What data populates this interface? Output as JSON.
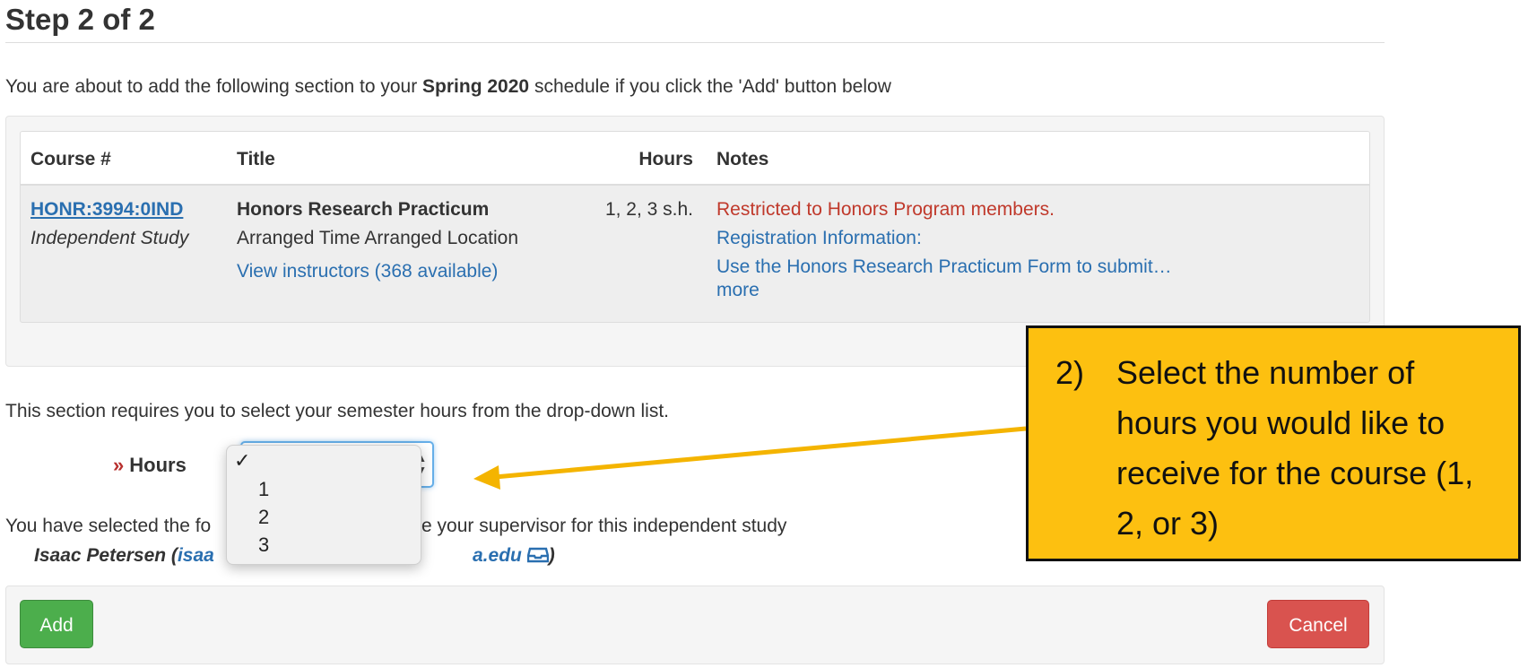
{
  "heading": {
    "title": "Step 2 of 2",
    "intro_prefix": "You are about to add the following section to your ",
    "intro_term": "Spring 2020",
    "intro_suffix": " schedule if you click the 'Add' button below"
  },
  "table": {
    "headers": {
      "course": "Course #",
      "title": "Title",
      "hours": "Hours",
      "notes": "Notes"
    },
    "row": {
      "course_code": "HONR:3994:0IND",
      "course_type": "Independent Study",
      "title": "Honors Research Practicum",
      "time_location": "Arranged Time Arranged Location",
      "instructors_link": "View instructors (368 available)",
      "hours": "1, 2, 3 s.h.",
      "note_restricted": "Restricted to Honors Program members.",
      "note_registration": "Registration Information:",
      "note_form": "Use the Honors Research Practicum Form to submit…",
      "note_more": "more"
    }
  },
  "hours_section": {
    "requirement_text": "This section requires you to select your semester hours from the drop-down list.",
    "label_chevron": "»",
    "label": "Hours",
    "select_arrows": "▲▼",
    "options": [
      {
        "check": "✓",
        "value": ""
      },
      {
        "check": "",
        "value": "1"
      },
      {
        "check": "",
        "value": "2"
      },
      {
        "check": "",
        "value": "3"
      }
    ]
  },
  "supervisor": {
    "prefix_visible": "You have selected the fo",
    "suffix_visible": "e your supervisor for this independent study",
    "name_prefix": "Isaac Petersen (",
    "email_start": "isaa",
    "email_end": "a.edu",
    "mail_icon": "inbox-icon",
    "closing": ")"
  },
  "footer": {
    "add_label": "Add",
    "cancel_label": "Cancel"
  },
  "callout": {
    "number": "2)",
    "text": "Select the number of hours you would like to receive for the course (1, 2, or 3)",
    "bg_color": "#fdc010"
  },
  "colors": {
    "link": "#2a6fb0",
    "restricted": "#c0392b",
    "add_button": "#4cae4c",
    "cancel_button": "#d9534f",
    "arrow": "#f4b400"
  }
}
